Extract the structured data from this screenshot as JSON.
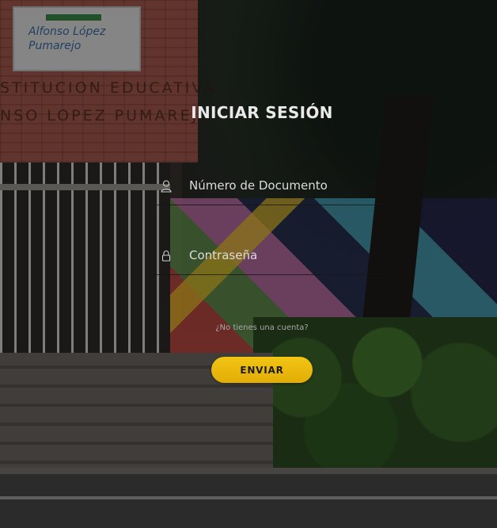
{
  "background": {
    "sign_line1": "Alfonso López",
    "sign_line2": "Pumarejo",
    "wall_line1": "STITUCION EDUCATIVA",
    "wall_line2": "NSO LOPEZ PUMAREJO"
  },
  "login": {
    "title": "INICIAR SESIÓN",
    "document_placeholder": "Número de Documento",
    "password_placeholder": "Contraseña",
    "signup_link": "¿No tienes una cuenta?",
    "submit_label": "ENVIAR"
  },
  "colors": {
    "accent": "#f2c514",
    "title_text": "#e9e9e9",
    "link_text": "#a8a8a8"
  },
  "icons": {
    "document_field": "user-icon",
    "password_field": "lock-icon"
  }
}
